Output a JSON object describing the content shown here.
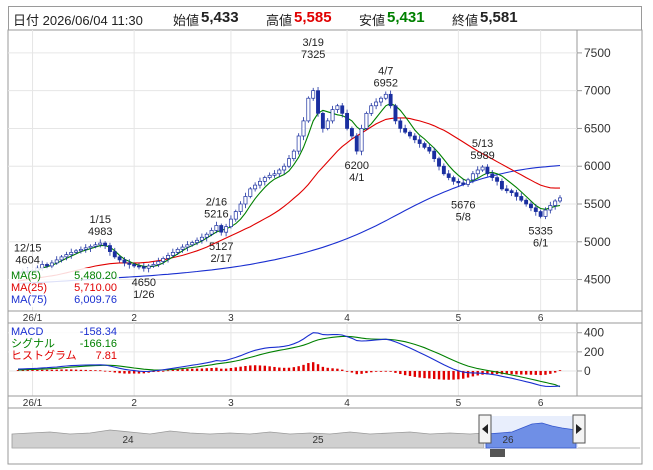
{
  "header": {
    "date_label": "日付 2026/06/04 11:30",
    "open_label": "始値",
    "open_value": "5,433",
    "high_label": "高値",
    "high_value": "5,585",
    "low_label": "安値",
    "low_value": "5,431",
    "close_label": "終値",
    "close_value": "5,581"
  },
  "colors": {
    "up_candle": "#ffffff",
    "down_candle": "#1a2fa0",
    "ma5": "#008000",
    "ma25": "#e00000",
    "ma75": "#1a2fd0",
    "macd": "#1a2fd0",
    "signal": "#008000",
    "histogram": "#e00000"
  },
  "legend_main": [
    {
      "label": "MA(5)",
      "value": "5,480.20",
      "color": "#008000"
    },
    {
      "label": "MA(25)",
      "value": "5,710.00",
      "color": "#e00000"
    },
    {
      "label": "MA(75)",
      "value": "6,009.76",
      "color": "#1a2fd0"
    }
  ],
  "legend_macd": [
    {
      "label": "MACD",
      "value": "-158.34",
      "color": "#1a2fd0"
    },
    {
      "label": "シグナル",
      "value": "-166.16",
      "color": "#008000"
    },
    {
      "label": "ヒストグラム",
      "value": "7.81",
      "color": "#e00000"
    }
  ],
  "month_labels": [
    "26/1",
    "2",
    "3",
    "4",
    "5",
    "6"
  ],
  "nav_labels": [
    "24",
    "25",
    "26"
  ],
  "chart_data": [
    {
      "type": "candlestick",
      "y_ticks": [
        4500,
        5000,
        5500,
        6000,
        6500,
        7000,
        7500
      ],
      "ylim": [
        4150,
        7750
      ],
      "annotations": [
        {
          "date": "12/15",
          "value": "4604",
          "position": "above"
        },
        {
          "date": "1/15",
          "value": "4983",
          "position": "above"
        },
        {
          "date": "1/26",
          "value": "4650",
          "position": "below"
        },
        {
          "date": "2/16",
          "value": "5216",
          "position": "above"
        },
        {
          "date": "2/17",
          "value": "5127",
          "position": "below"
        },
        {
          "date": "3/19",
          "value": "7325",
          "position": "above"
        },
        {
          "date": "4/1",
          "value": "6200",
          "position": "below"
        },
        {
          "date": "4/7",
          "value": "6952",
          "position": "above"
        },
        {
          "date": "5/13",
          "value": "5989",
          "position": "above"
        },
        {
          "date": "5/8",
          "value": "5676",
          "position": "below"
        },
        {
          "date": "6/1",
          "value": "5335",
          "position": "below"
        }
      ],
      "closes": [
        4600,
        4610,
        4604,
        4620,
        4650,
        4700,
        4680,
        4720,
        4760,
        4800,
        4830,
        4860,
        4880,
        4900,
        4920,
        4940,
        4960,
        4983,
        4950,
        4870,
        4800,
        4760,
        4720,
        4700,
        4680,
        4670,
        4650,
        4680,
        4700,
        4740,
        4780,
        4820,
        4860,
        4900,
        4930,
        4960,
        4990,
        5020,
        5060,
        5100,
        5150,
        5216,
        5127,
        5200,
        5300,
        5400,
        5500,
        5600,
        5700,
        5750,
        5800,
        5850,
        5880,
        5900,
        5950,
        6000,
        6100,
        6200,
        6400,
        6600,
        6900,
        7000,
        6700,
        6500,
        6600,
        6750,
        6800,
        6700,
        6500,
        6400,
        6200,
        6500,
        6700,
        6800,
        6850,
        6900,
        6952,
        6800,
        6600,
        6500,
        6450,
        6400,
        6350,
        6300,
        6250,
        6200,
        6100,
        6000,
        5900,
        5850,
        5800,
        5780,
        5760,
        5820,
        5900,
        5950,
        5989,
        5900,
        5850,
        5800,
        5700,
        5676,
        5650,
        5600,
        5550,
        5500,
        5450,
        5400,
        5335,
        5420,
        5480,
        5540,
        5581
      ],
      "ma5": [
        4580,
        4590,
        4600,
        4610,
        4625,
        4650,
        4670,
        4690,
        4715,
        4750,
        4780,
        4810,
        4840,
        4870,
        4890,
        4910,
        4930,
        4950,
        4950,
        4930,
        4880,
        4820,
        4770,
        4740,
        4710,
        4690,
        4675,
        4670,
        4675,
        4690,
        4720,
        4760,
        4800,
        4840,
        4880,
        4920,
        4950,
        4980,
        5010,
        5050,
        5090,
        5130,
        5150,
        5170,
        5200,
        5240,
        5300,
        5380,
        5480,
        5570,
        5650,
        5720,
        5780,
        5830,
        5860,
        5890,
        5940,
        6020,
        6120,
        6250,
        6420,
        6600,
        6700,
        6740,
        6720,
        6700,
        6680,
        6670,
        6640,
        6600,
        6520,
        6470,
        6500,
        6560,
        6640,
        6720,
        6800,
        6830,
        6800,
        6740,
        6660,
        6570,
        6480,
        6410,
        6360,
        6300,
        6240,
        6170,
        6090,
        6010,
        5940,
        5880,
        5830,
        5800,
        5810,
        5840,
        5880,
        5910,
        5920,
        5900,
        5870,
        5820,
        5770,
        5720,
        5660,
        5600,
        5540,
        5480,
        5440,
        5430,
        5450,
        5470,
        5480
      ],
      "ma25": [
        4480,
        4490,
        4500,
        4510,
        4520,
        4530,
        4540,
        4550,
        4560,
        4575,
        4590,
        4605,
        4620,
        4635,
        4650,
        4665,
        4680,
        4690,
        4700,
        4710,
        4715,
        4720,
        4720,
        4720,
        4720,
        4720,
        4725,
        4730,
        4740,
        4750,
        4760,
        4775,
        4790,
        4805,
        4820,
        4840,
        4860,
        4880,
        4905,
        4930,
        4960,
        4990,
        5020,
        5050,
        5080,
        5110,
        5140,
        5170,
        5200,
        5235,
        5270,
        5305,
        5340,
        5380,
        5420,
        5470,
        5520,
        5575,
        5630,
        5690,
        5760,
        5840,
        5920,
        5990,
        6060,
        6130,
        6200,
        6260,
        6310,
        6360,
        6400,
        6440,
        6480,
        6520,
        6560,
        6590,
        6620,
        6630,
        6640,
        6640,
        6640,
        6630,
        6615,
        6600,
        6580,
        6560,
        6535,
        6505,
        6475,
        6440,
        6400,
        6360,
        6320,
        6280,
        6240,
        6200,
        6165,
        6130,
        6095,
        6060,
        6025,
        5990,
        5955,
        5920,
        5885,
        5850,
        5815,
        5780,
        5750,
        5730,
        5715,
        5710,
        5710
      ],
      "ma75": [
        4450,
        4452,
        4455,
        4458,
        4460,
        4463,
        4466,
        4470,
        4474,
        4478,
        4482,
        4486,
        4490,
        4494,
        4498,
        4502,
        4506,
        4510,
        4514,
        4518,
        4522,
        4526,
        4530,
        4534,
        4538,
        4542,
        4546,
        4550,
        4555,
        4560,
        4565,
        4570,
        4576,
        4582,
        4588,
        4594,
        4600,
        4607,
        4614,
        4621,
        4628,
        4636,
        4644,
        4652,
        4661,
        4670,
        4680,
        4690,
        4701,
        4712,
        4724,
        4736,
        4749,
        4762,
        4776,
        4790,
        4805,
        4820,
        4836,
        4852,
        4870,
        4888,
        4907,
        4927,
        4948,
        4970,
        4993,
        5017,
        5042,
        5068,
        5095,
        5123,
        5152,
        5182,
        5213,
        5245,
        5278,
        5312,
        5346,
        5380,
        5414,
        5447,
        5480,
        5512,
        5543,
        5573,
        5602,
        5630,
        5657,
        5683,
        5708,
        5732,
        5755,
        5777,
        5798,
        5818,
        5837,
        5855,
        5872,
        5888,
        5903,
        5917,
        5930,
        5942,
        5953,
        5963,
        5972,
        5980,
        5987,
        5993,
        5999,
        6004,
        6009
      ],
      "macd": [
        20,
        22,
        24,
        26,
        28,
        32,
        34,
        38,
        42,
        48,
        52,
        56,
        58,
        60,
        62,
        63,
        64,
        65,
        62,
        52,
        40,
        28,
        18,
        10,
        4,
        -2,
        -6,
        -4,
        0,
        6,
        12,
        20,
        28,
        36,
        44,
        52,
        60,
        68,
        76,
        86,
        96,
        108,
        104,
        112,
        126,
        142,
        160,
        180,
        200,
        216,
        228,
        238,
        244,
        248,
        252,
        258,
        268,
        284,
        306,
        334,
        370,
        400,
        396,
        380,
        378,
        380,
        382,
        376,
        360,
        342,
        318,
        314,
        316,
        320,
        324,
        328,
        332,
        322,
        304,
        284,
        262,
        240,
        216,
        192,
        168,
        144,
        118,
        92,
        66,
        42,
        20,
        2,
        -12,
        -18,
        -20,
        -22,
        -24,
        -30,
        -36,
        -44,
        -56,
        -66,
        -76,
        -88,
        -100,
        -112,
        -124,
        -138,
        -152,
        -160,
        -162,
        -160,
        -158
      ],
      "signal": [
        10,
        12,
        14,
        16,
        18,
        20,
        22,
        25,
        28,
        32,
        36,
        40,
        44,
        48,
        51,
        54,
        56,
        58,
        60,
        59,
        56,
        51,
        45,
        38,
        31,
        25,
        19,
        14,
        11,
        10,
        11,
        13,
        16,
        20,
        25,
        30,
        36,
        43,
        50,
        57,
        65,
        74,
        80,
        87,
        95,
        104,
        115,
        128,
        142,
        156,
        170,
        183,
        195,
        206,
        216,
        225,
        234,
        244,
        256,
        270,
        287,
        308,
        325,
        337,
        345,
        352,
        358,
        362,
        362,
        359,
        352,
        344,
        338,
        334,
        332,
        331,
        331,
        329,
        324,
        316,
        306,
        293,
        278,
        261,
        243,
        223,
        202,
        180,
        157,
        134,
        111,
        89,
        69,
        51,
        37,
        25,
        15,
        6,
        -3,
        -12,
        -22,
        -32,
        -42,
        -52,
        -63,
        -74,
        -85,
        -97,
        -109,
        -120,
        -132,
        -143,
        -166
      ]
    }
  ]
}
